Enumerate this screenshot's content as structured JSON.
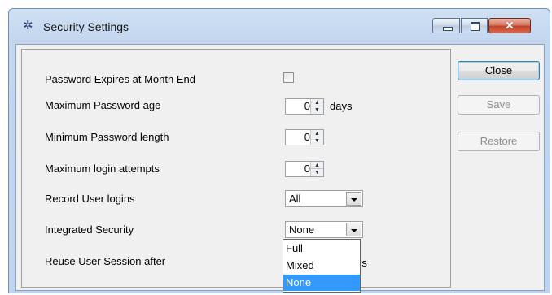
{
  "window": {
    "title": "Security Settings",
    "icon": "gear-icon",
    "controls": {
      "minimize": "minimize",
      "maximize": "maximize",
      "close": "✕"
    }
  },
  "settings": {
    "password_expires": {
      "label": "Password Expires at Month End",
      "checked": false
    },
    "max_password_age": {
      "label": "Maximum Password age",
      "value": "0",
      "unit": "days"
    },
    "min_password_length": {
      "label": "Minimum Password length",
      "value": "0"
    },
    "max_login_attempts": {
      "label": "Maximum login attempts",
      "value": "0"
    },
    "record_user_logins": {
      "label": "Record User logins",
      "value": "All"
    },
    "integrated_security": {
      "label": "Integrated Security",
      "value": "None",
      "options": [
        "Full",
        "Mixed",
        "None"
      ],
      "highlighted_option": "None"
    },
    "reuse_user_session": {
      "label": "Reuse User Session after",
      "unit_partial": "rs"
    }
  },
  "buttons": {
    "close": "Close",
    "save": "Save",
    "restore": "Restore"
  },
  "colors": {
    "selection": "#3399ff",
    "title_bar": "#c3d6ee",
    "close_button": "#c0452b"
  }
}
